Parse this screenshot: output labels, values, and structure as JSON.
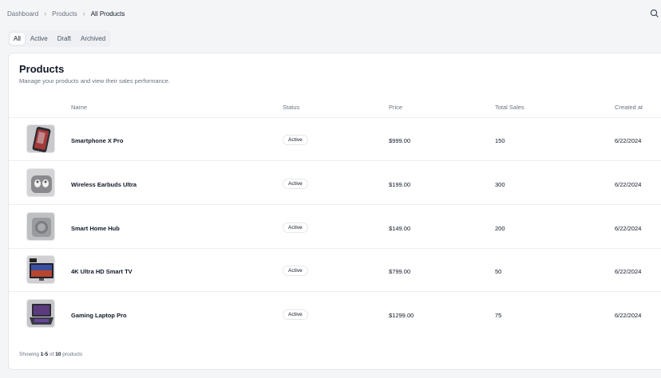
{
  "breadcrumb": {
    "items": [
      "Dashboard",
      "Products",
      "All Products"
    ]
  },
  "tabs": [
    "All",
    "Active",
    "Draft",
    "Archived"
  ],
  "card": {
    "title": "Products",
    "description": "Manage your products and view their sales performance."
  },
  "table": {
    "columns": [
      "Name",
      "Status",
      "Price",
      "Total Sales",
      "Created at"
    ],
    "rows": [
      {
        "name": "Smartphone X Pro",
        "status": "Active",
        "price": "$999.00",
        "sales": "150",
        "created": "6/22/2024"
      },
      {
        "name": "Wireless Earbuds Ultra",
        "status": "Active",
        "price": "$199.00",
        "sales": "300",
        "created": "6/22/2024"
      },
      {
        "name": "Smart Home Hub",
        "status": "Active",
        "price": "$149.00",
        "sales": "200",
        "created": "6/22/2024"
      },
      {
        "name": "4K Ultra HD Smart TV",
        "status": "Active",
        "price": "$799.00",
        "sales": "50",
        "created": "6/22/2024"
      },
      {
        "name": "Gaming Laptop Pro",
        "status": "Active",
        "price": "$1299.00",
        "sales": "75",
        "created": "6/22/2024"
      }
    ]
  },
  "footer": {
    "prefix": "Showing",
    "range": "1-5",
    "of": "of",
    "total": "10",
    "suffix": "products"
  },
  "icons": [
    "search-icon"
  ],
  "colors": {
    "background": "#f4f5f7",
    "card": "#ffffff",
    "muted_text": "#6b7280"
  }
}
